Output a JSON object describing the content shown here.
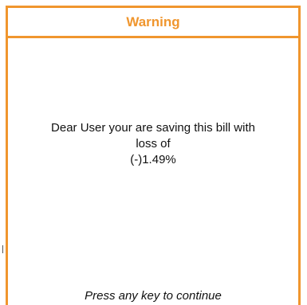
{
  "dialog": {
    "title": "Warning",
    "message_line_1": "Dear User your are saving this bill with",
    "message_line_2": "loss of",
    "loss_value": "(-)1.49%",
    "hint": "Press any key to continue",
    "accent_color": "#f0962e"
  }
}
